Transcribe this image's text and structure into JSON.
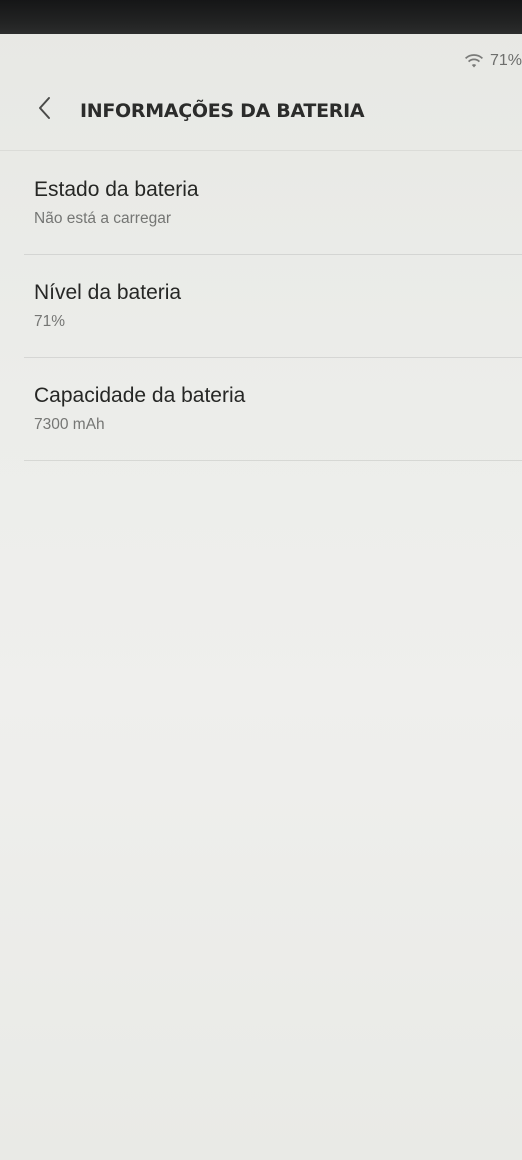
{
  "status_bar": {
    "battery_text": "71%",
    "wifi_icon": "wifi-icon"
  },
  "header": {
    "back_icon": "chevron-left-icon",
    "title": "INFORMAÇÕES DA BATERIA"
  },
  "items": [
    {
      "title": "Estado da bateria",
      "value": "Não está a carregar"
    },
    {
      "title": "Nível da bateria",
      "value": "71%"
    },
    {
      "title": "Capacidade da bateria",
      "value": "7300 mAh"
    }
  ]
}
